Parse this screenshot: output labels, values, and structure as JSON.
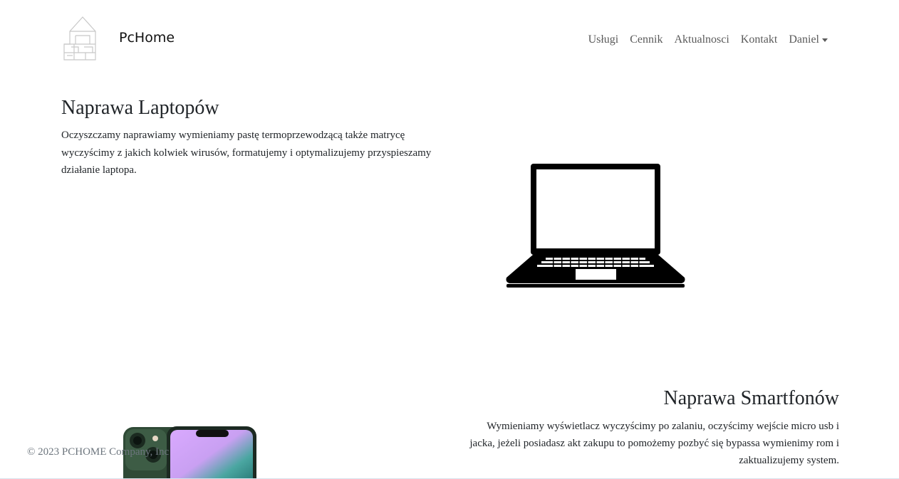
{
  "header": {
    "brand": "PcHome",
    "logo_icon": "house-outline-icon",
    "nav": {
      "uslugi": "Usługi",
      "cennik": "Cennik",
      "aktualnosci": "Aktualnosci",
      "kontakt": "Kontakt",
      "user": "Daniel",
      "user_dropdown_icon": "caret-down-icon"
    }
  },
  "laptop_section": {
    "title": "Naprawa Laptopów",
    "text": "Oczyszczamy naprawiamy wymieniamy pastę termoprzewodzącą także matrycę wyczyścimy z jakich kolwiek wirusów, formatujemy i optymalizujemy przyspieszamy działanie laptopa.",
    "image_icon": "laptop-icon"
  },
  "phone_section": {
    "title": "Naprawa Smartfonów",
    "text": "Wymieniamy wyświetlacz wyczyścimy po zalaniu, oczyścimy wejście micro usb i jacka, jeżeli posiadasz akt zakupu to pomożemy pozbyć się bypassa wymienimy rom i zaktualizujemy system.",
    "image_icon": "smartphone-image"
  },
  "footer": {
    "copyright": "© 2023 PCHOME Company, Inc"
  },
  "colors": {
    "text": "#212529",
    "nav_link": "#5a5a5a",
    "footer_text": "#6c757d",
    "phone_green": "#2f4a36"
  }
}
